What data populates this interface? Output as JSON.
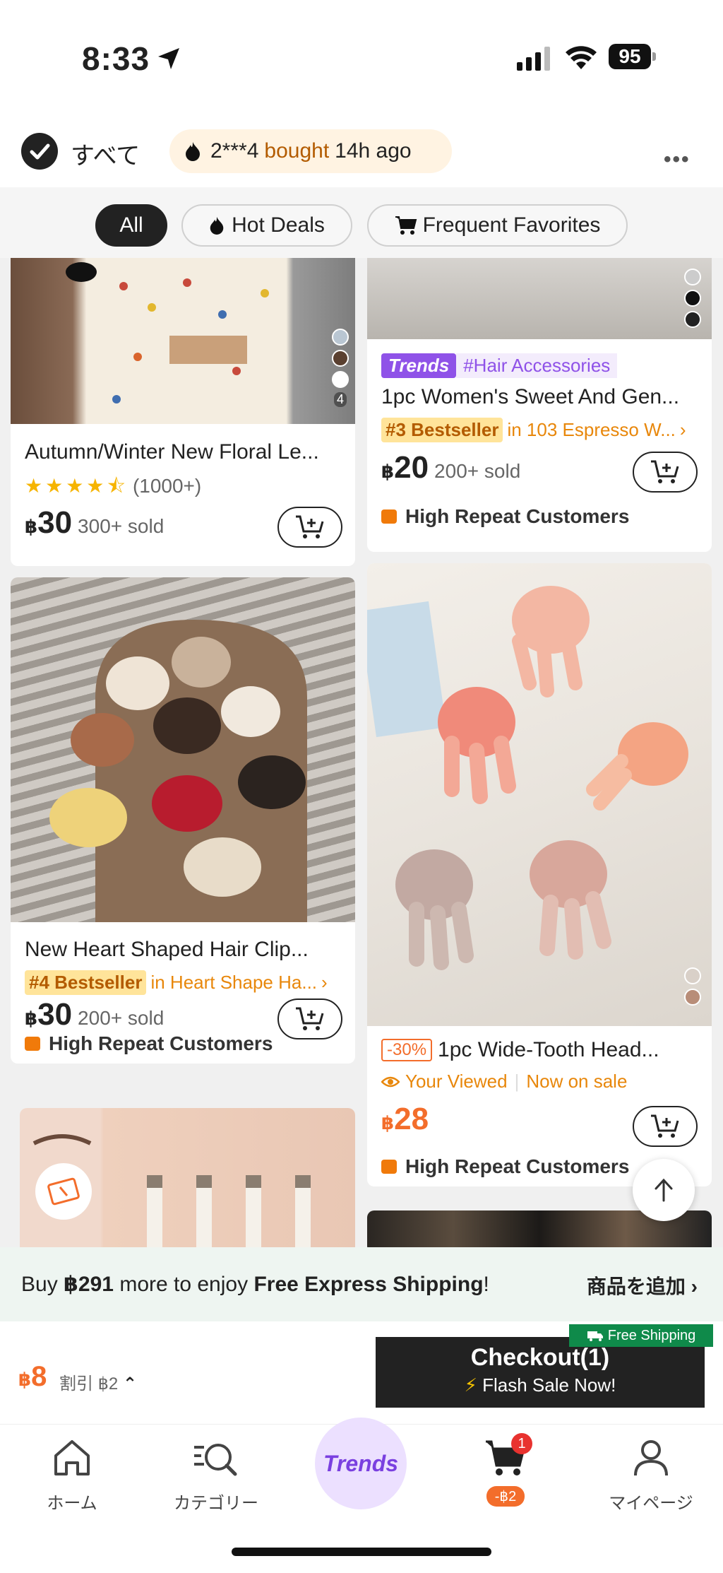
{
  "status_bar": {
    "time": "8:33",
    "battery": "95"
  },
  "top_row": {
    "select_all_label": "すべて",
    "bought_user": "2***4",
    "bought_word": "bought",
    "bought_time": "14h ago"
  },
  "filters": [
    {
      "label": "All",
      "active": true
    },
    {
      "label": "Hot Deals",
      "icon": "fire-icon"
    },
    {
      "label": "Frequent Favorites",
      "icon": "cart-icon"
    }
  ],
  "products": [
    {
      "title": "Autumn/Winter New Floral Le...",
      "rating_stars": 4.5,
      "rating_count": "(1000+)",
      "currency": "฿",
      "price": "30",
      "sold": "300+ sold",
      "swatch_count": "4",
      "image_desc": "floral phone case"
    },
    {
      "trend_logo": "Trends",
      "trend_hashtag": "#Hair Accessories",
      "title": "1pc Women's Sweet And Gen...",
      "bestseller_tag": "#3 Bestseller",
      "bestseller_in": "in 103 Espresso W...",
      "currency": "฿",
      "price": "20",
      "sold": "200+ sold",
      "repeat": "High Repeat Customers"
    },
    {
      "title": "New Heart Shaped Hair Clip...",
      "bestseller_tag": "#4 Bestseller",
      "bestseller_in": "in Heart Shape Ha...",
      "currency": "฿",
      "price": "30",
      "sold": "200+ sold",
      "repeat": "High Repeat Customers"
    },
    {
      "discount": "-30%",
      "title": "1pc Wide-Tooth Head...",
      "viewed": "Your Viewed",
      "on_sale": "Now on sale",
      "currency": "฿",
      "price": "28",
      "repeat": "High Repeat Customers"
    }
  ],
  "shipping_banner": {
    "prefix": "Buy",
    "amount": "฿291",
    "middle": "more to enjoy",
    "bold": "Free Express Shipping",
    "suffix": "!",
    "add_items": "商品を追加"
  },
  "checkout": {
    "currency": "฿",
    "total": "8",
    "discount_note": "割引 ฿2",
    "button_label": "Checkout(1)",
    "flash": "Flash Sale Now!",
    "free_shipping": "Free Shipping"
  },
  "tabbar": {
    "home": "ホーム",
    "category": "カテゴリー",
    "trends": "Trends",
    "cart_badge": "1",
    "cart_discount": "-฿2",
    "mypage": "マイページ"
  },
  "colors": {
    "accent": "#f36d2b",
    "trends_purple": "#8f52e8",
    "bestseller_bg": "#ffe49a"
  }
}
